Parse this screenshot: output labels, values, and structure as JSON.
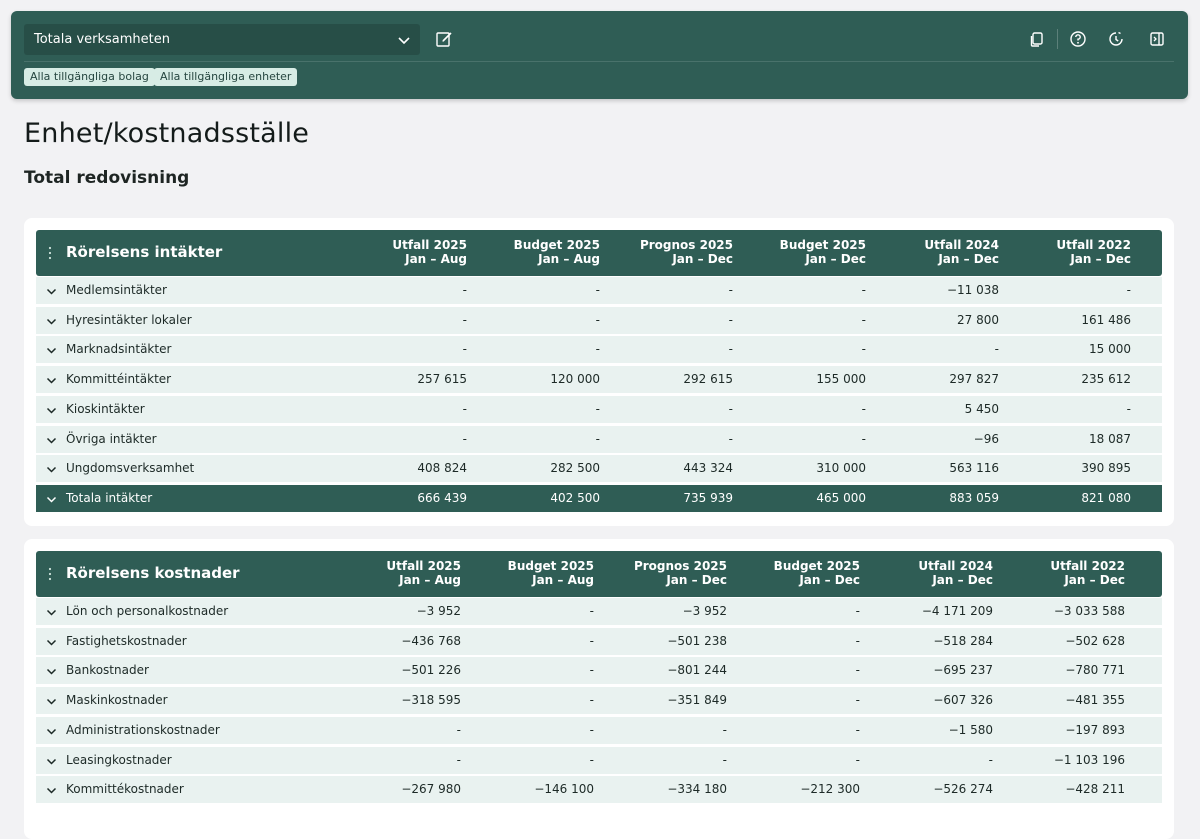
{
  "toolbar": {
    "selected_view": "Totala verksamheten",
    "chips": [
      "Alla tillgängliga bolag",
      "Alla tillgängliga enheter"
    ]
  },
  "page": {
    "title": "Enhet/kostnadsställe",
    "subtitle": "Total redovisning"
  },
  "columns": [
    {
      "line1": "Utfall 2025",
      "line2": "Jan – Aug"
    },
    {
      "line1": "Budget 2025",
      "line2": "Jan – Aug"
    },
    {
      "line1": "Prognos 2025",
      "line2": "Jan – Dec"
    },
    {
      "line1": "Budget 2025",
      "line2": "Jan – Dec"
    },
    {
      "line1": "Utfall 2024",
      "line2": "Jan – Dec"
    },
    {
      "line1": "Utfall 2022",
      "line2": "Jan – Dec"
    }
  ],
  "income": {
    "title": "Rörelsens intäkter",
    "rows": [
      {
        "label": "Medlemsintäkter",
        "values": [
          "-",
          "-",
          "-",
          "-",
          "−11 038",
          "-"
        ]
      },
      {
        "label": "Hyresintäkter lokaler",
        "values": [
          "-",
          "-",
          "-",
          "-",
          "27 800",
          "161 486"
        ]
      },
      {
        "label": "Marknadsintäkter",
        "values": [
          "-",
          "-",
          "-",
          "-",
          "-",
          "15 000"
        ]
      },
      {
        "label": "Kommittéintäkter",
        "values": [
          "257 615",
          "120 000",
          "292 615",
          "155 000",
          "297 827",
          "235 612"
        ]
      },
      {
        "label": "Kioskintäkter",
        "values": [
          "-",
          "-",
          "-",
          "-",
          "5 450",
          "-"
        ]
      },
      {
        "label": "Övriga intäkter",
        "values": [
          "-",
          "-",
          "-",
          "-",
          "−96",
          "18 087"
        ]
      },
      {
        "label": "Ungdomsverksamhet",
        "values": [
          "408 824",
          "282 500",
          "443 324",
          "310 000",
          "563 116",
          "390 895"
        ]
      },
      {
        "label": "Totala intäkter",
        "values": [
          "666 439",
          "402 500",
          "735 939",
          "465 000",
          "883 059",
          "821 080"
        ],
        "total": true
      }
    ]
  },
  "costs": {
    "title": "Rörelsens kostnader",
    "rows": [
      {
        "label": "Lön och personalkostnader",
        "values": [
          "−3 952",
          "-",
          "−3 952",
          "-",
          "−4 171 209",
          "−3 033 588"
        ]
      },
      {
        "label": "Fastighetskostnader",
        "values": [
          "−436 768",
          "-",
          "−501 238",
          "-",
          "−518 284",
          "−502 628"
        ]
      },
      {
        "label": "Bankostnader",
        "values": [
          "−501 226",
          "-",
          "−801 244",
          "-",
          "−695 237",
          "−780 771"
        ]
      },
      {
        "label": "Maskinkostnader",
        "values": [
          "−318 595",
          "-",
          "−351 849",
          "-",
          "−607 326",
          "−481 355"
        ]
      },
      {
        "label": "Administrationskostnader",
        "values": [
          "-",
          "-",
          "-",
          "-",
          "−1 580",
          "−197 893"
        ]
      },
      {
        "label": "Leasingkostnader",
        "values": [
          "-",
          "-",
          "-",
          "-",
          "-",
          "−1 103 196"
        ]
      },
      {
        "label": "Kommittékostnader",
        "values": [
          "−267 980",
          "−146 100",
          "−334 180",
          "−212 300",
          "−526 274",
          "−428 211"
        ]
      }
    ]
  },
  "icons": {
    "toolbar_right": [
      "copy-icon",
      "help-icon",
      "history-icon",
      "sidebar-toggle-icon"
    ]
  },
  "colors": {
    "brand": "#2f5d55",
    "row_bg": "#e9f2f0",
    "chip_bg": "#d7ece5"
  }
}
